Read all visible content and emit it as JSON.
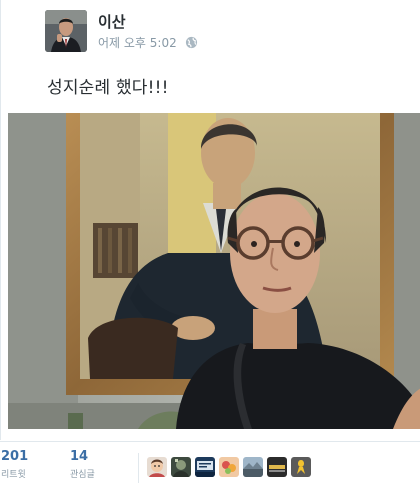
{
  "tweet": {
    "display_name": "이산",
    "timestamp": "어제 오후 5:02",
    "privacy_icon": "globe-icon",
    "text": "성지순례 했다!!!",
    "photo": "attached-photo"
  },
  "stats": {
    "retweets": {
      "count": "201",
      "label": "리트윗"
    },
    "favorites": {
      "count": "14",
      "label": "관심글"
    }
  },
  "favoriters": [
    {
      "icon": "favoriter-avatar-1"
    },
    {
      "icon": "favoriter-avatar-2"
    },
    {
      "icon": "favoriter-avatar-3"
    },
    {
      "icon": "favoriter-avatar-4"
    },
    {
      "icon": "favoriter-avatar-5"
    },
    {
      "icon": "favoriter-avatar-6"
    },
    {
      "icon": "favoriter-avatar-7"
    }
  ]
}
